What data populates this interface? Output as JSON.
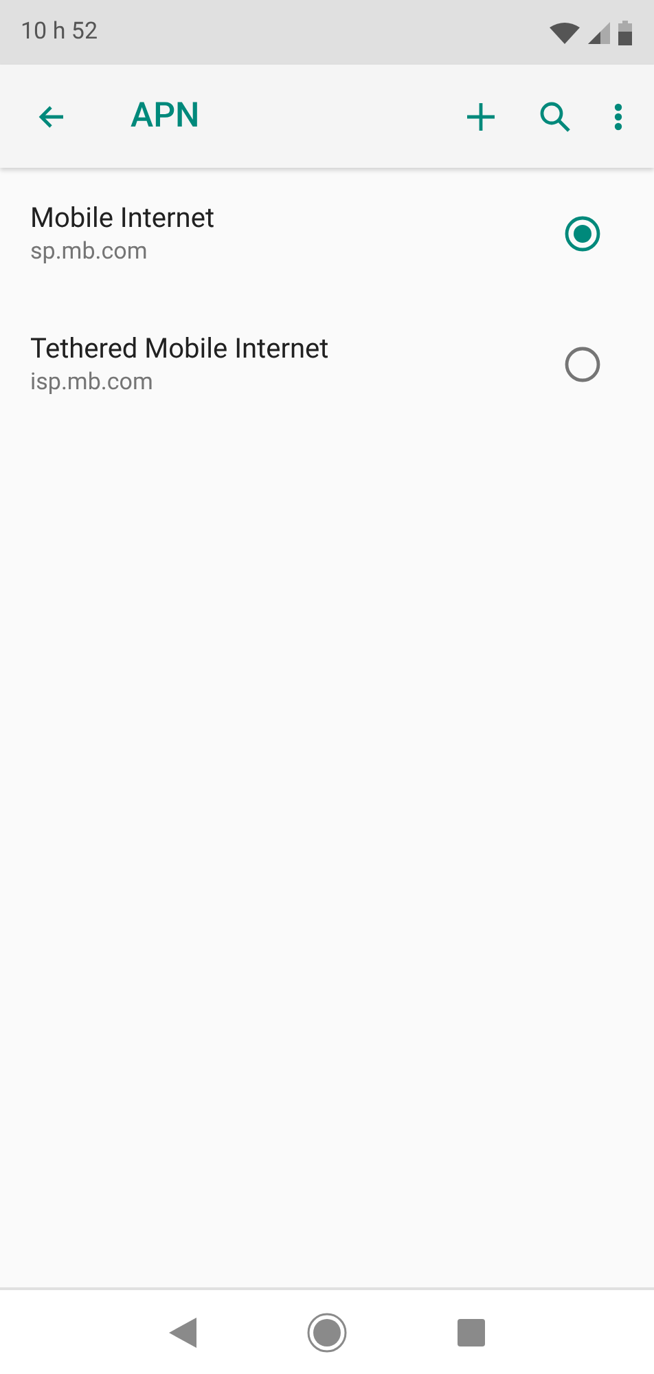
{
  "status_bar": {
    "time": "10 h 52"
  },
  "app_bar": {
    "title": "APN"
  },
  "apns": [
    {
      "name": "Mobile Internet",
      "apn": "sp.mb.com",
      "selected": true
    },
    {
      "name": "Tethered Mobile Internet",
      "apn": "isp.mb.com",
      "selected": false
    }
  ]
}
